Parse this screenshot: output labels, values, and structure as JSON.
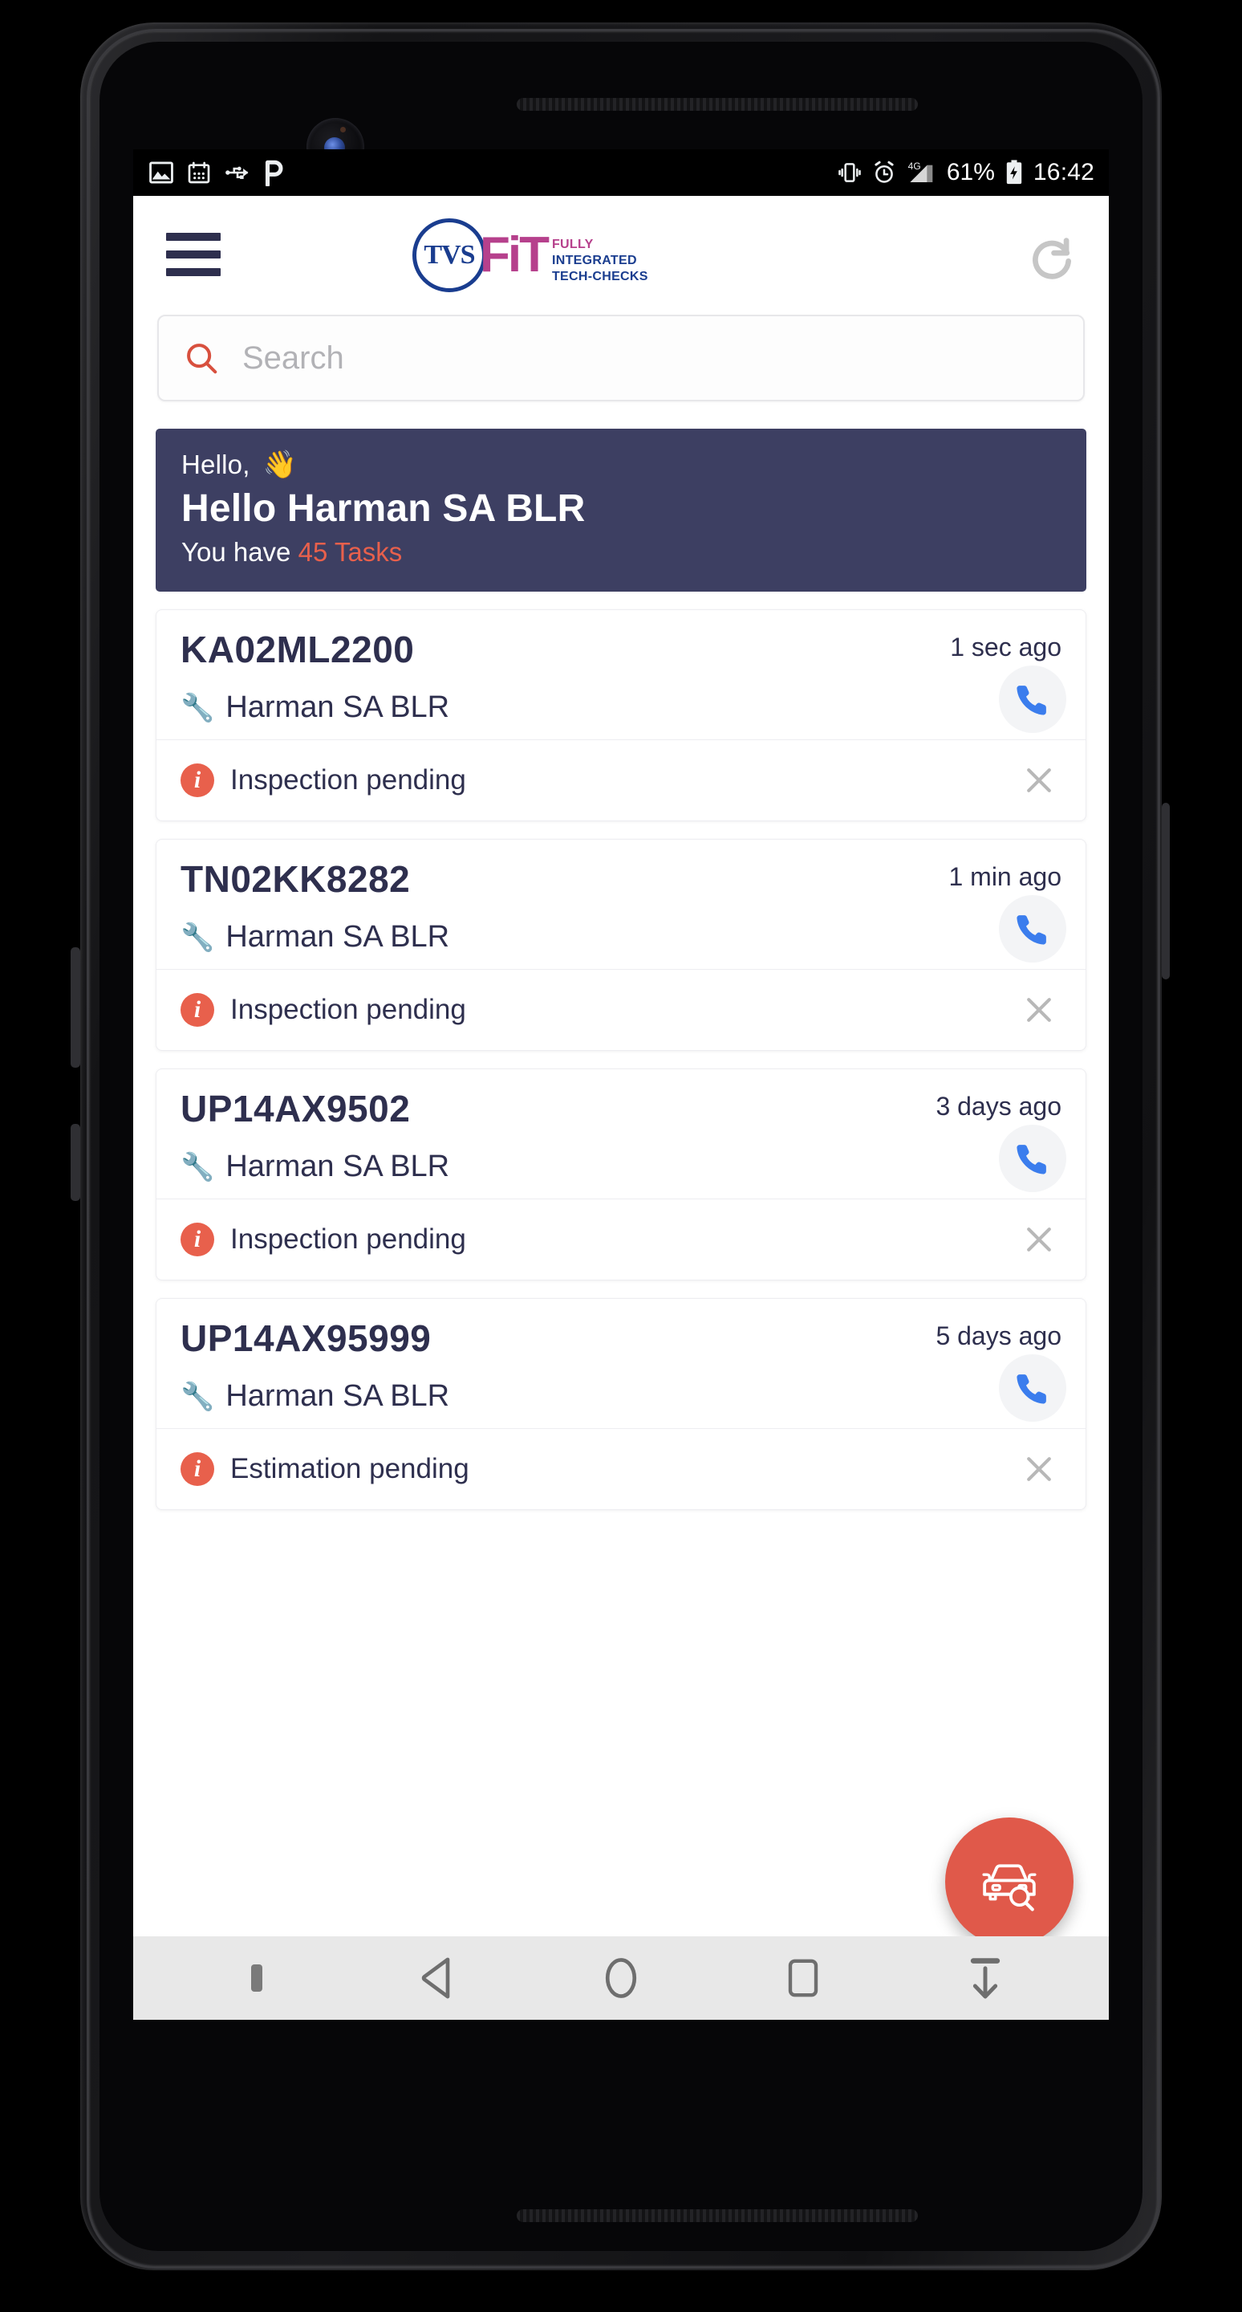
{
  "status_bar": {
    "left_icons": [
      "image-icon",
      "calendar-icon",
      "usb-icon",
      "p-app-icon"
    ],
    "right_icons": [
      "vibrate-icon",
      "alarm-icon",
      "signal-4g-icon",
      "battery-charging-icon"
    ],
    "network": "4G",
    "battery_percent": "61%",
    "time": "16:42"
  },
  "appbar": {
    "menu_icon": "hamburger-menu-icon",
    "refresh_icon": "refresh-icon",
    "logo": {
      "mark": "TVS",
      "name": "FiT",
      "tagline_line1": "FULLY",
      "tagline_line2": "INTEGRATED",
      "tagline_line3": "TECH-CHECKS"
    }
  },
  "search": {
    "icon": "search-icon",
    "placeholder": "Search",
    "value": ""
  },
  "greeting": {
    "hello": "Hello,",
    "wave": "👋",
    "name": "Hello Harman SA BLR",
    "tasks_prefix": "You have ",
    "tasks_count": "45 Tasks"
  },
  "colors": {
    "banner_bg": "#3d3f62",
    "accent_red": "#e8604c",
    "fab_bg": "#e0594a",
    "navy_text": "#2e2f4e",
    "call_blue": "#3b7ded",
    "logo_blue": "#1a3d8f",
    "logo_magenta": "#b6408c"
  },
  "task_cards": [
    {
      "registration": "KA02ML2200",
      "time_ago": "1 sec ago",
      "location": "Harman SA BLR",
      "location_icon": "wrench-icon",
      "status": "Inspection pending",
      "status_icon": "info-icon",
      "call_icon": "phone-icon",
      "close_icon": "close-icon"
    },
    {
      "registration": "TN02KK8282",
      "time_ago": "1 min ago",
      "location": "Harman SA BLR",
      "location_icon": "wrench-icon",
      "status": "Inspection pending",
      "status_icon": "info-icon",
      "call_icon": "phone-icon",
      "close_icon": "close-icon"
    },
    {
      "registration": "UP14AX9502",
      "time_ago": "3 days ago",
      "location": "Harman SA BLR",
      "location_icon": "wrench-icon",
      "status": "Inspection pending",
      "status_icon": "info-icon",
      "call_icon": "phone-icon",
      "close_icon": "close-icon"
    },
    {
      "registration": "UP14AX95999",
      "time_ago": "5 days ago",
      "location": "Harman SA BLR",
      "location_icon": "wrench-icon",
      "status": "Estimation pending",
      "status_icon": "info-icon",
      "call_icon": "phone-icon",
      "close_icon": "close-icon"
    }
  ],
  "fab": {
    "icon": "car-inspection-icon"
  },
  "nav_bar": {
    "buttons": [
      "ime-switcher-icon",
      "back-icon",
      "home-icon",
      "recents-icon",
      "hide-keyboard-icon"
    ]
  }
}
